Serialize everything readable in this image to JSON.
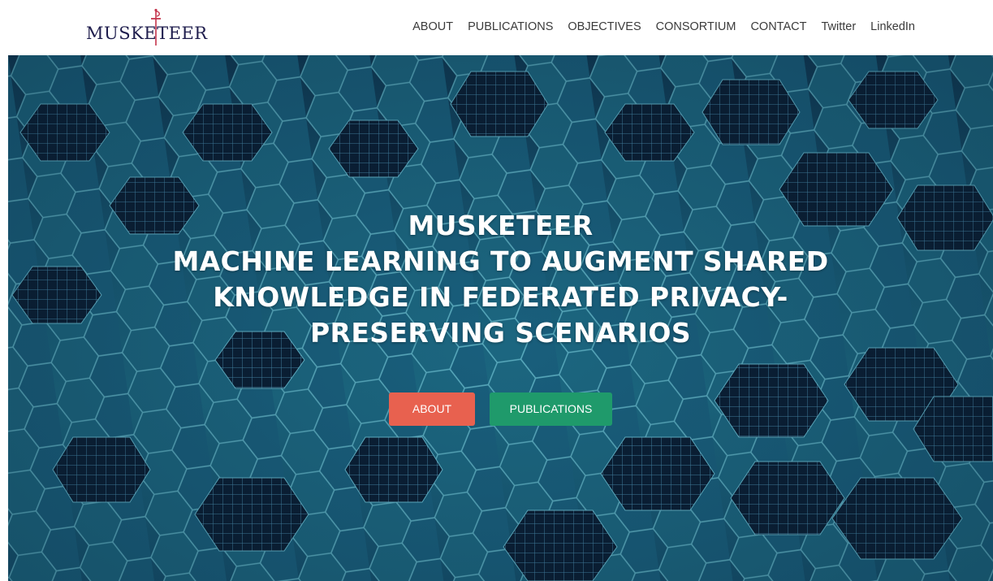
{
  "brand": {
    "name": "MUSKETEER",
    "colors": {
      "text": "#1f1d4d",
      "sword": "#c4354d"
    }
  },
  "nav": {
    "items": [
      {
        "label": "ABOUT",
        "name": "nav-about"
      },
      {
        "label": "PUBLICATIONS",
        "name": "nav-publications"
      },
      {
        "label": "OBJECTIVES",
        "name": "nav-objectives"
      },
      {
        "label": "CONSORTIUM",
        "name": "nav-consortium"
      },
      {
        "label": "CONTACT",
        "name": "nav-contact"
      },
      {
        "label": "Twitter",
        "name": "nav-twitter"
      },
      {
        "label": "LinkedIn",
        "name": "nav-linkedin"
      }
    ]
  },
  "hero": {
    "title": "MUSKETEER",
    "subtitle": "MACHINE LEARNING TO AUGMENT SHARED KNOWLEDGE IN FEDERATED PRIVACY-PRESERVING SCENARIOS",
    "buttons": {
      "about_label": "ABOUT",
      "publications_label": "PUBLICATIONS"
    }
  },
  "colors": {
    "about_button": "#e8614f",
    "publications_button": "#1f9a6b",
    "hero_background": "#175a76"
  }
}
